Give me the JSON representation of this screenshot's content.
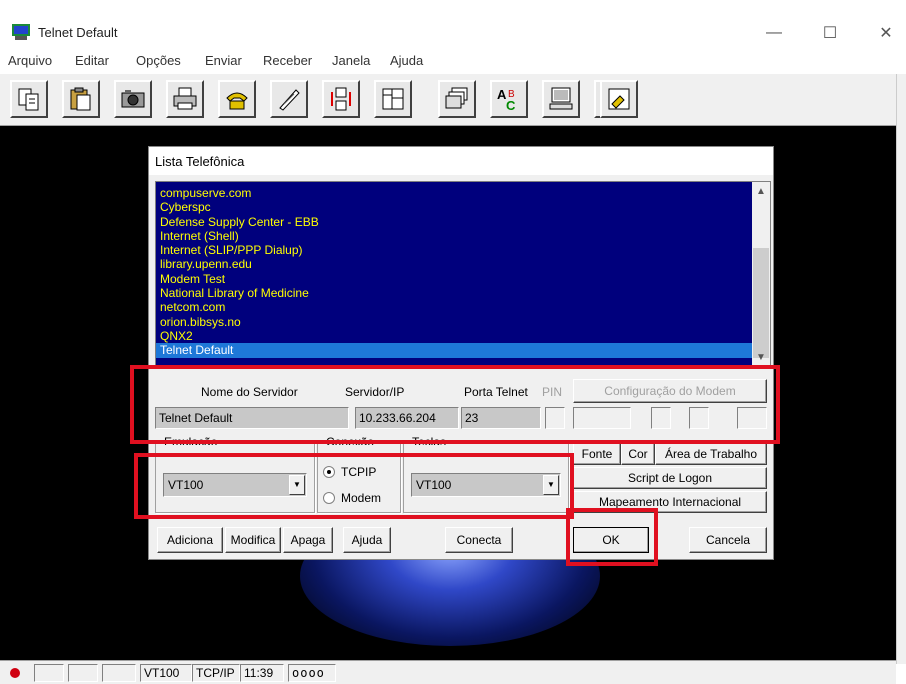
{
  "window": {
    "title": "Telnet Default",
    "minimize_glyph": "—",
    "maximize_glyph": "☐",
    "close_glyph": "✕"
  },
  "menu": [
    "Arquivo",
    "Editar",
    "Opções",
    "Enviar",
    "Receber",
    "Janela",
    "Ajuda"
  ],
  "toolbar_icons": [
    "copy-icon",
    "paste-icon",
    "camera-icon",
    "print-icon",
    "phone-icon",
    "hangup-icon",
    "network-icon",
    "layout-icon",
    "stack-icon",
    "spell-icon",
    "monitor-icon",
    "keyboard-icon",
    "notes-icon"
  ],
  "dialog": {
    "title": "Lista Telefônica",
    "entries": [
      "compuserve.com",
      "Cyberspc",
      "Defense Supply Center - EBB",
      "Internet (Shell)",
      "Internet (SLIP/PPP Dialup)",
      "library.upenn.edu",
      "Modem Test",
      "National Library of Medicine",
      "netcom.com",
      "orion.bibsys.no",
      "QNX2",
      "Telnet Default"
    ],
    "selected_entry": "Telnet Default",
    "labels": {
      "server_name": "Nome do Servidor",
      "server_ip": "Servidor/IP",
      "telnet_port": "Porta Telnet",
      "pin": "PIN",
      "modem_config": "Configuração do Modem"
    },
    "values": {
      "server_name": "Telnet Default",
      "server_ip": "10.233.66.204",
      "telnet_port": "23"
    },
    "groups": {
      "emulation": "Emulação",
      "connection": "Conexão",
      "keys": "Teclas"
    },
    "emulation_value": "VT100",
    "keys_value": "VT100",
    "connection_options": [
      "TCPIP",
      "Modem"
    ],
    "connection_selected": "TCPIP",
    "side_buttons": {
      "font": "Fonte",
      "color": "Cor",
      "desktop_area": "Área de Trabalho",
      "logon_script": "Script de Logon",
      "intl_mapping": "Mapeamento Internacional"
    },
    "bottom_buttons": {
      "add": "Adiciona",
      "modify": "Modifica",
      "delete": "Apaga",
      "help": "Ajuda",
      "connect": "Conecta",
      "ok": "OK",
      "cancel": "Cancela"
    }
  },
  "statusbar": {
    "emulation": "VT100",
    "protocol": "TCP/IP",
    "time": "11:39",
    "indicators": "oooo"
  },
  "colors": {
    "list_background": "#00007d",
    "list_text": "#ffff00",
    "selection": "#1e78d8",
    "highlight_box": "#e01020",
    "terminal_background": "#000000"
  }
}
